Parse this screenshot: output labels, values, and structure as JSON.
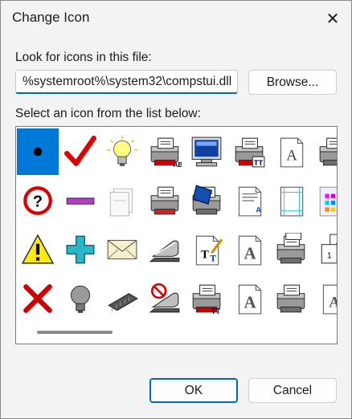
{
  "window": {
    "title": "Change Icon",
    "close_glyph": "✕"
  },
  "file_label": "Look for icons in this file:",
  "file_path": "%systemroot%\\system32\\compstui.dll",
  "browse_label": "Browse...",
  "list_label": "Select an icon from the list below:",
  "ok_label": "OK",
  "cancel_label": "Cancel",
  "icons": [
    [
      "dot-icon",
      "checkmark-icon",
      "lightbulb-on-icon",
      "printer-font-ab-icon",
      "monitor-icon",
      "printer-truetype-icon",
      "font-document-icon",
      "printer-paper-icon"
    ],
    [
      "help-question-icon",
      "purple-bar-icon",
      "document-pages-icon",
      "printer-red-tray-icon",
      "printer-blue-page-icon",
      "printer-doc-icon",
      "page-layout-icon",
      "color-swatches-icon"
    ],
    [
      "warning-icon",
      "plus-cross-icon",
      "envelope-icon",
      "stapler-icon",
      "font-edit-icon",
      "font-a-document-icon",
      "printer-stack-icon",
      "pages-numbered-icon"
    ],
    [
      "red-x-icon",
      "lightbulb-off-icon",
      "memory-chip-icon",
      "no-stapler-icon",
      "printer-tt-icon",
      "font-a-page-icon",
      "printer-gray-icon",
      "font-a-partial-icon"
    ]
  ],
  "selected_icon": "dot-icon"
}
